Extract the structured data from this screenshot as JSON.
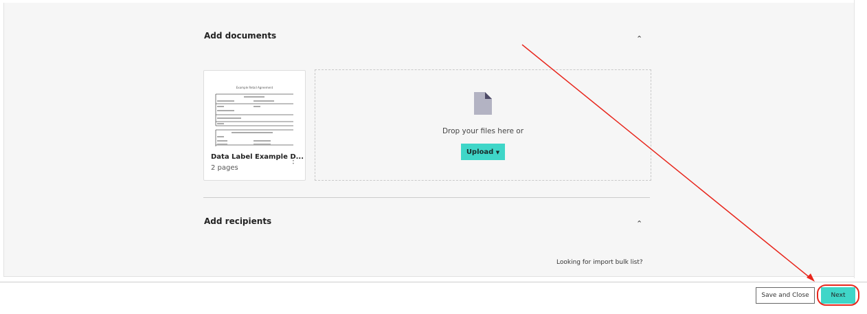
{
  "sections": {
    "documents": {
      "title": "Add documents",
      "collapse_icon": "chevron-up"
    },
    "recipients": {
      "title": "Add recipients",
      "collapse_icon": "chevron-up"
    }
  },
  "document_card": {
    "title": "Data Label Example D...",
    "pages": "2 pages",
    "thumbnail_heading": "Example Retail Agreement"
  },
  "dropzone": {
    "text": "Drop your files here or",
    "upload_label": "Upload",
    "icon": "file-icon"
  },
  "import_link": "Looking for import bulk list?",
  "footer": {
    "save_label": "Save and Close",
    "next_label": "Next"
  },
  "colors": {
    "accent": "#3fd6c8",
    "annotation": "#e8261c"
  }
}
